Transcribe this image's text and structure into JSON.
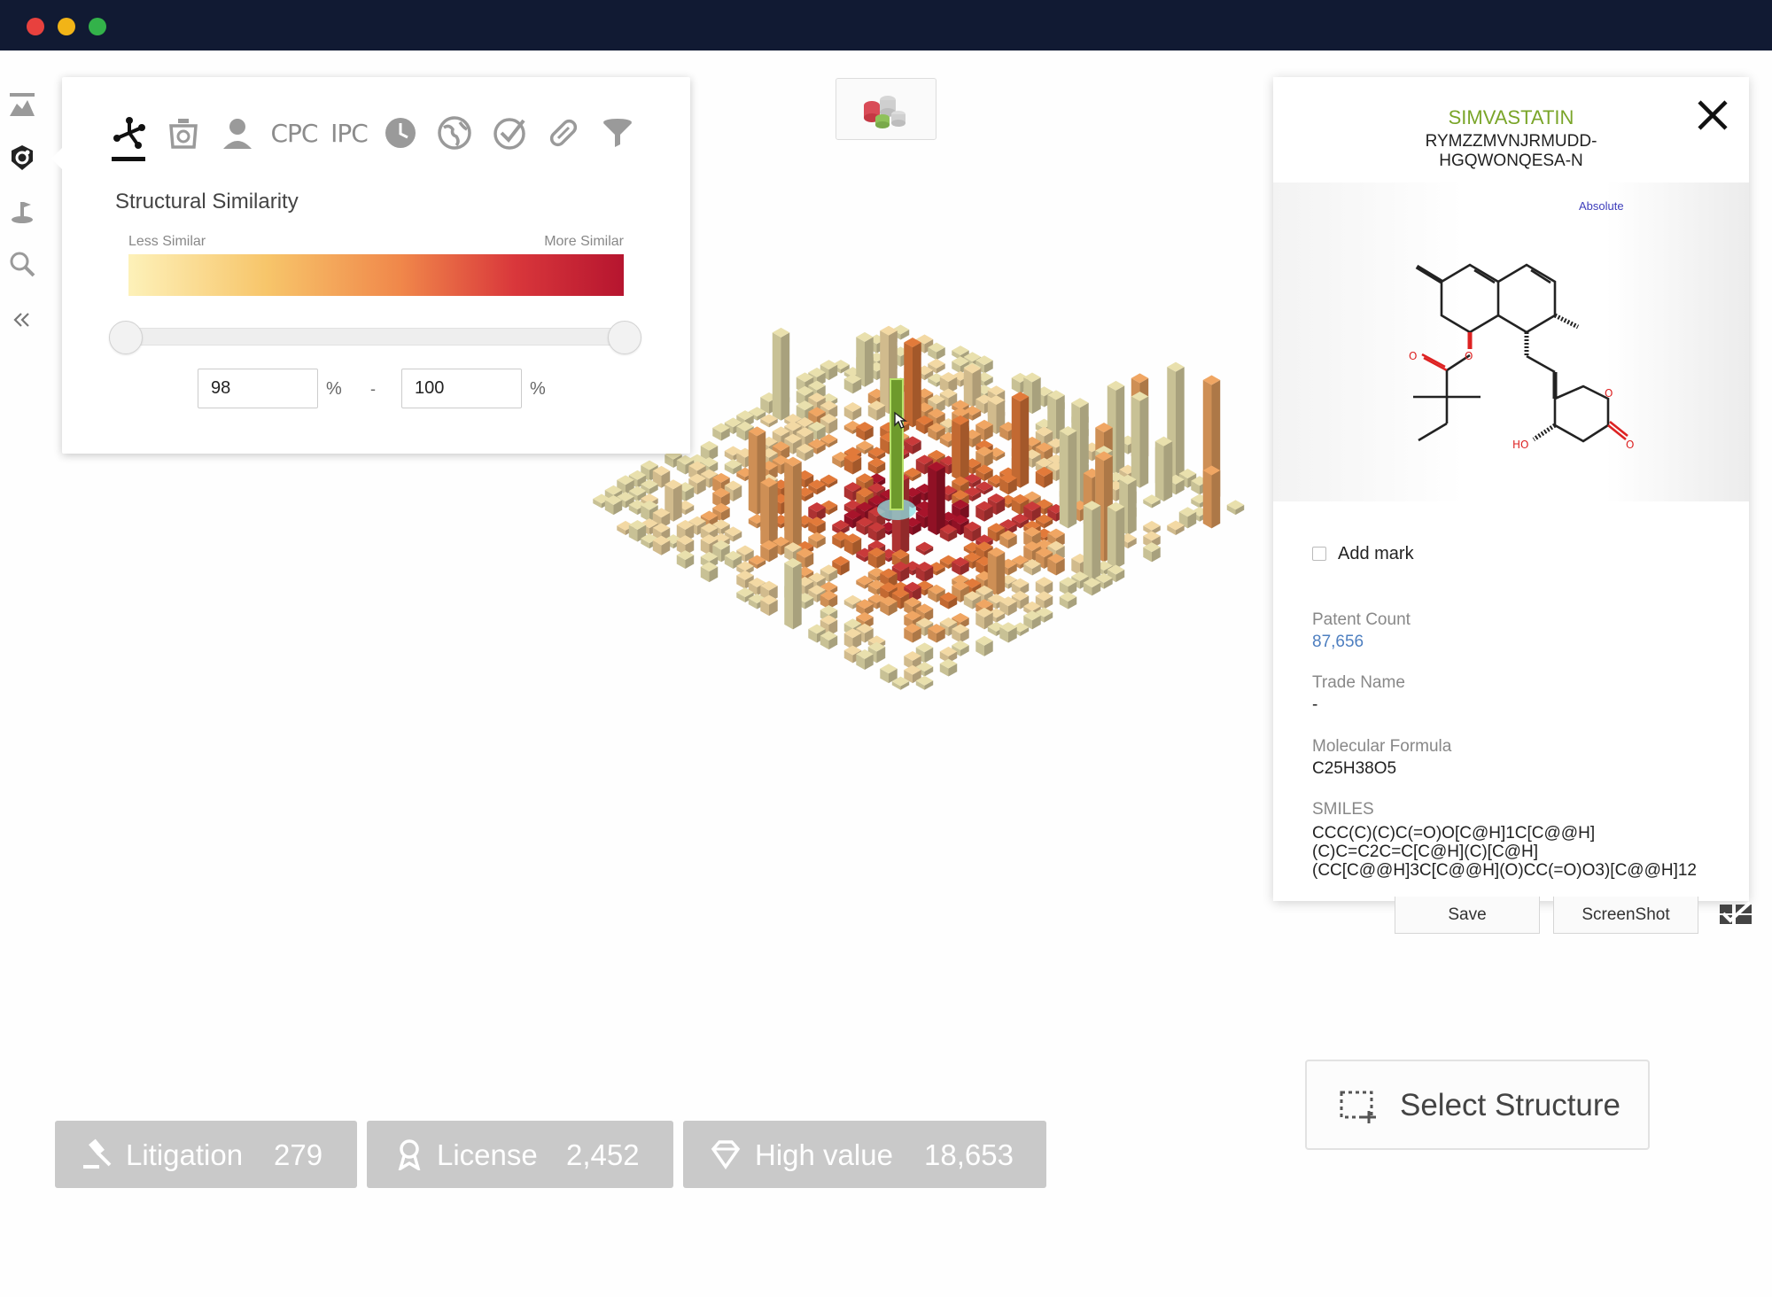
{
  "window": {
    "traffic_lights": [
      "close",
      "minimize",
      "maximize"
    ]
  },
  "colors": {
    "titlebar": "#111a33",
    "accent_green": "#7aa529",
    "link_blue": "#4e7fc0",
    "gradient": [
      "#fdf1b9",
      "#f7c56a",
      "#f0874a",
      "#d9373b",
      "#b6152f"
    ],
    "bar_palette": [
      "#e9e0ad",
      "#f3d9a4",
      "#f0a663",
      "#e27a3a",
      "#c93a3a",
      "#a8142b"
    ]
  },
  "left_rail": {
    "items": [
      {
        "name": "landscape-icon"
      },
      {
        "name": "molecule-shield-icon"
      },
      {
        "name": "location-pin-icon"
      },
      {
        "name": "search-icon"
      },
      {
        "name": "collapse-double-chevron-icon"
      }
    ]
  },
  "filter_panel": {
    "tabs": [
      {
        "name": "structure-icon",
        "text": ""
      },
      {
        "name": "weight-icon",
        "text": ""
      },
      {
        "name": "person-icon",
        "text": ""
      },
      {
        "name": "cpc-tab",
        "text": "CPC"
      },
      {
        "name": "ipc-tab",
        "text": "IPC"
      },
      {
        "name": "clock-icon",
        "text": ""
      },
      {
        "name": "globe-icon",
        "text": ""
      },
      {
        "name": "check-circle-icon",
        "text": ""
      },
      {
        "name": "pill-icon",
        "text": ""
      },
      {
        "name": "filter-funnel-icon",
        "text": ""
      }
    ],
    "active_tab": "structure-icon",
    "heading": "Structural Similarity",
    "less_label": "Less Similar",
    "more_label": "More Similar",
    "range_min": "98",
    "range_max": "100",
    "percent": "%",
    "separator": "-"
  },
  "top_icon_button": {
    "name": "compound-groups-icon"
  },
  "detail": {
    "name": "SIMVASTATIN",
    "inchi_key": "RYMZZMVNJRMUDD-HGQWONQESA-N",
    "inchi_key_line1": "RYMZZMVNJRMUDD-",
    "inchi_key_line2": "HGQWONQESA-N",
    "stereo_label": "Absolute",
    "add_mark_label": "Add mark",
    "add_mark_checked": false,
    "patent_count_label": "Patent Count",
    "patent_count": "87,656",
    "trade_name_label": "Trade Name",
    "trade_name": "-",
    "formula_label": "Molecular Formula",
    "formula": "C25H38O5",
    "smiles_label": "SMILES",
    "smiles_line1": "CCC(C)(C)C(=O)O[C@H]1C[C@@H]",
    "smiles_line2": "(C)C=C2C=C[C@H](C)[C@H]",
    "smiles_line3": "(CC[C@@H]3C[C@@H](O)CC(=O)O3)[C@@H]12"
  },
  "actions": {
    "save_label": "Save",
    "screenshot_label": "ScreenShot",
    "select_structure_label": "Select Structure"
  },
  "stats": [
    {
      "label": "Litigation",
      "value": "279",
      "icon": "gavel-icon"
    },
    {
      "label": "License",
      "value": "2,452",
      "icon": "ribbon-icon"
    },
    {
      "label": "High value",
      "value": "18,653",
      "icon": "diamond-icon"
    }
  ]
}
